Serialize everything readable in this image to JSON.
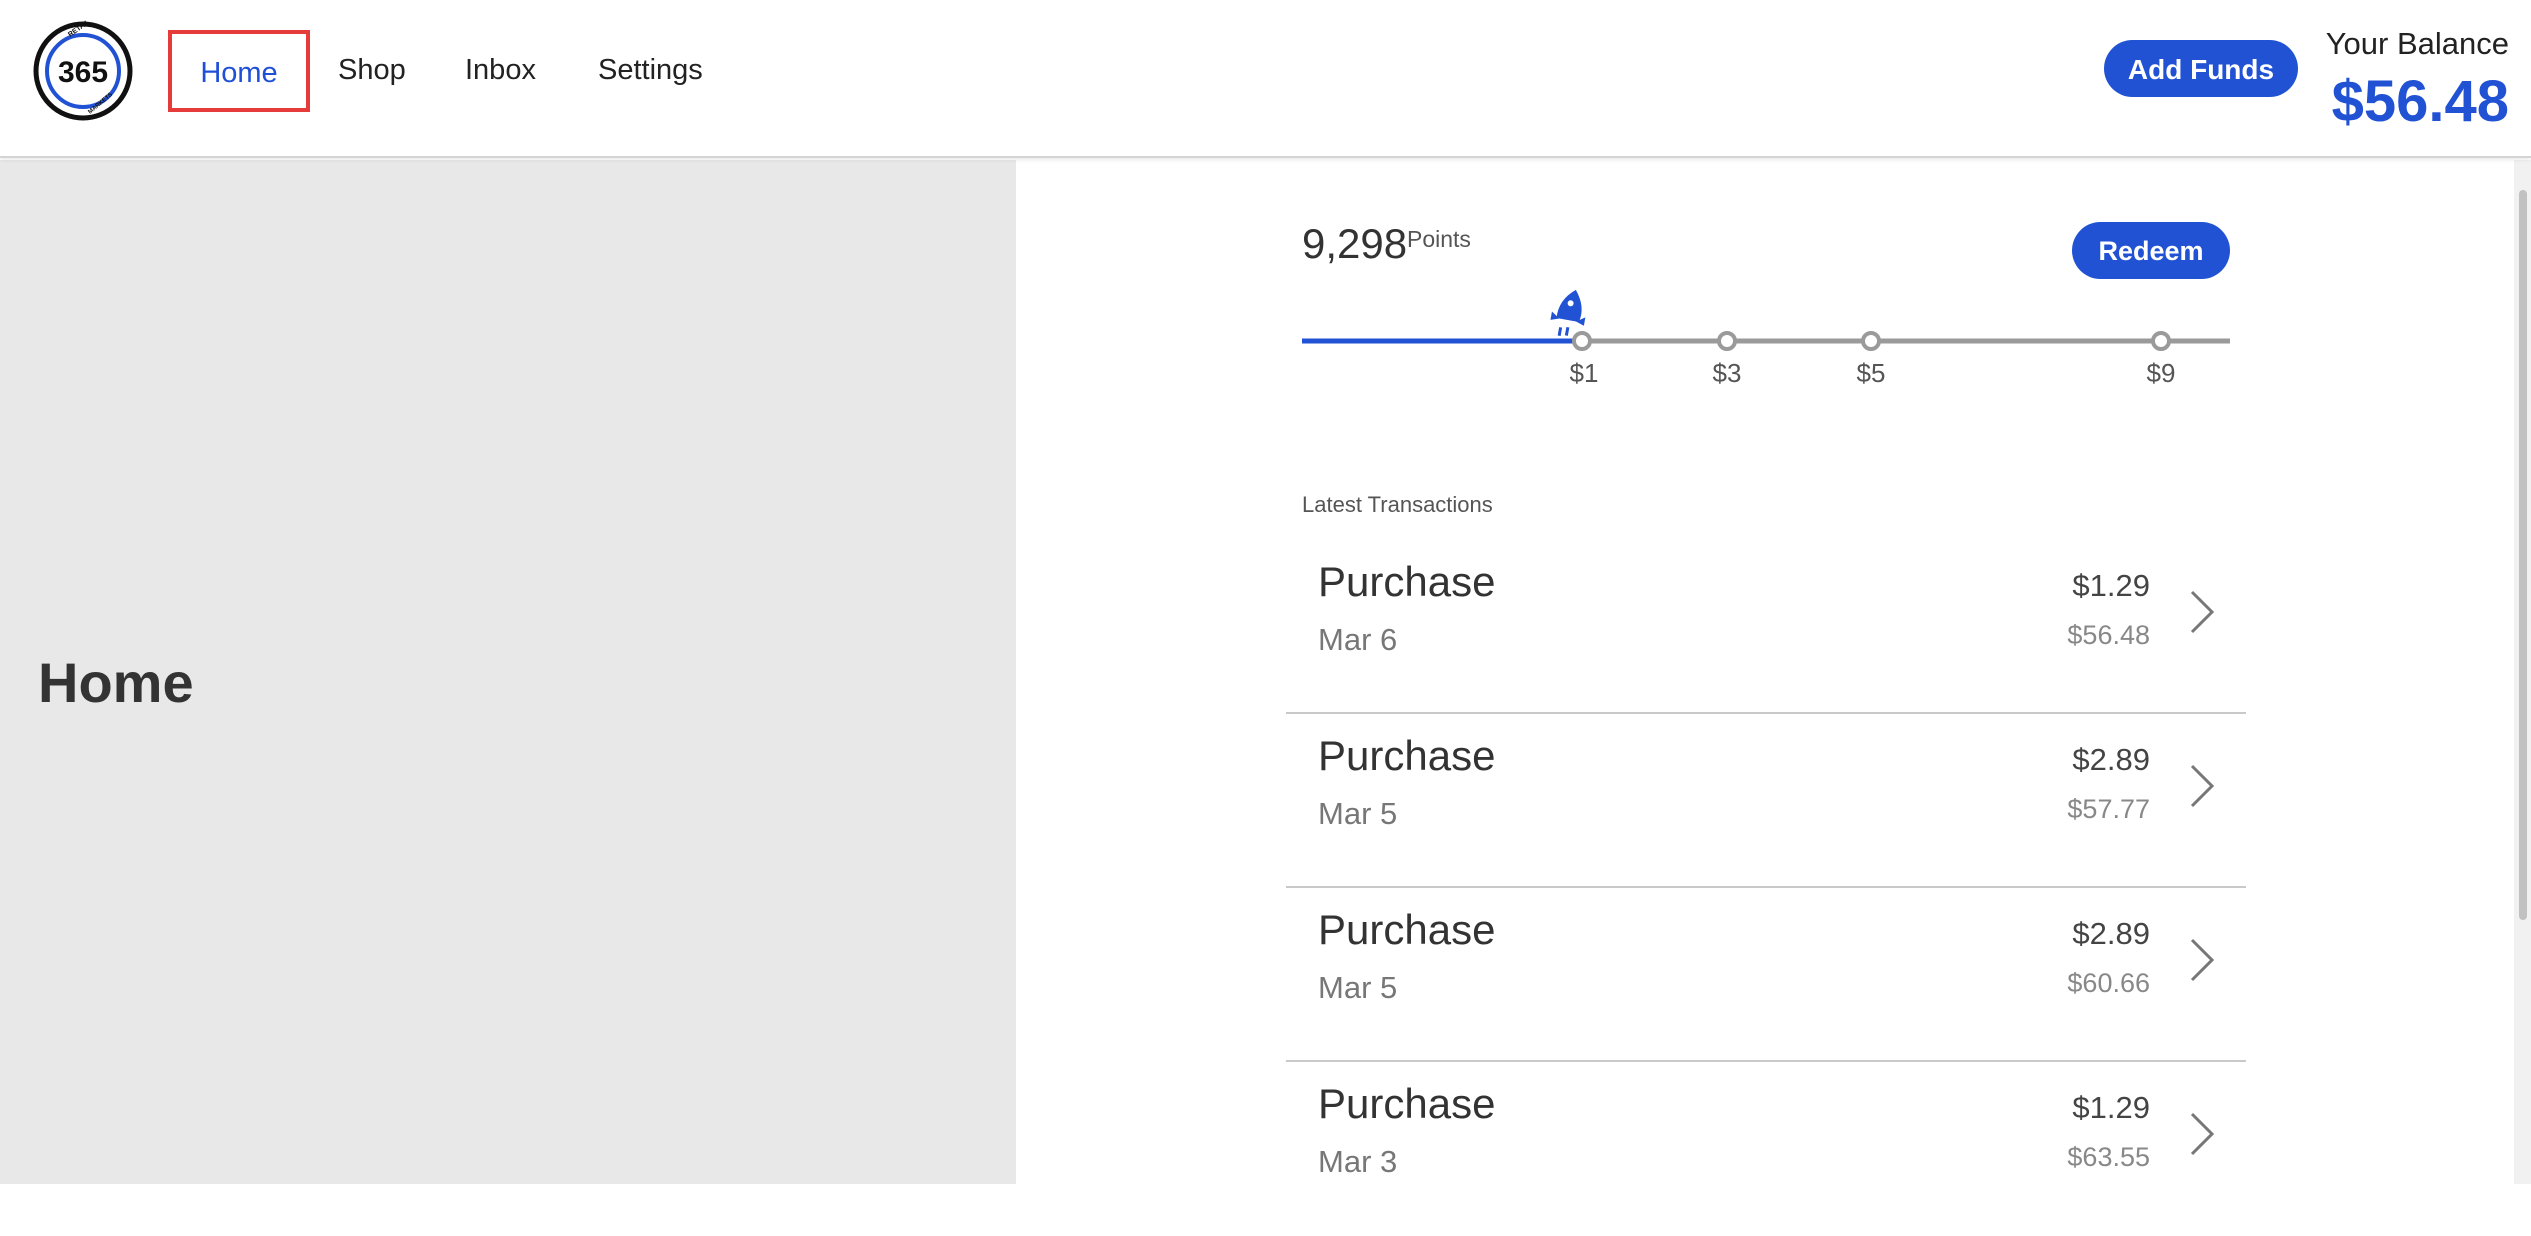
{
  "header": {
    "logo": {
      "number": "365",
      "top_text": "RETAIL",
      "bottom_text": "MARKETS",
      "icon": "365-retail-markets-logo"
    },
    "nav": [
      {
        "label": "Home",
        "active": true
      },
      {
        "label": "Shop",
        "active": false
      },
      {
        "label": "Inbox",
        "active": false
      },
      {
        "label": "Settings",
        "active": false
      }
    ],
    "add_funds_label": "Add Funds",
    "balance_label": "Your Balance",
    "balance_amount": "$56.48"
  },
  "left_panel": {
    "title": "Home"
  },
  "rewards": {
    "points": "9,298",
    "points_label": "Points",
    "redeem_label": "Redeem",
    "progress_icon": "rocket-icon",
    "milestones": [
      "$1",
      "$3",
      "$5",
      "$9"
    ],
    "progress_fraction": 0.3
  },
  "transactions": {
    "section_title": "Latest Transactions",
    "items": [
      {
        "type": "Purchase",
        "date": "Mar 6",
        "amount": "$1.29",
        "balance": "$56.48"
      },
      {
        "type": "Purchase",
        "date": "Mar 5",
        "amount": "$2.89",
        "balance": "$57.77"
      },
      {
        "type": "Purchase",
        "date": "Mar 5",
        "amount": "$2.89",
        "balance": "$60.66"
      },
      {
        "type": "Purchase",
        "date": "Mar 3",
        "amount": "$1.29",
        "balance": "$63.55"
      }
    ]
  },
  "colors": {
    "accent": "#2152d4",
    "highlight_border": "#e53b3b",
    "left_panel_bg": "#e8e8e8",
    "track_gray": "#9a9a9a"
  }
}
